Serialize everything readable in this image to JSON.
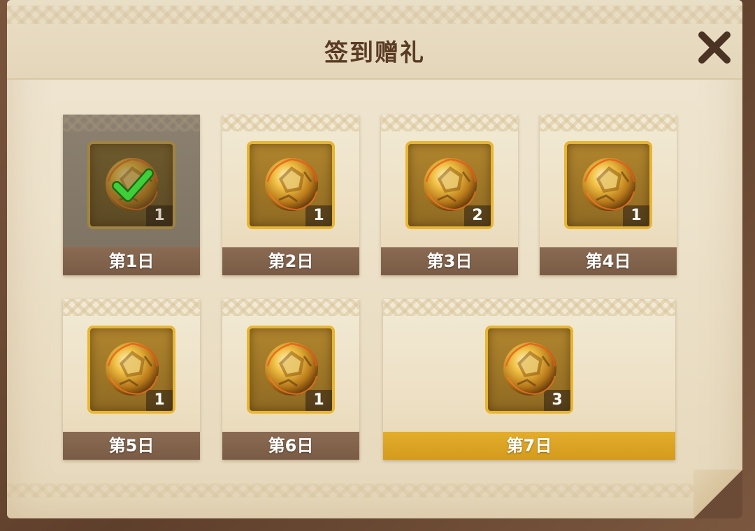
{
  "dialog": {
    "title": "签到赠礼",
    "close_icon": "close-icon"
  },
  "days": [
    {
      "label": "第1日",
      "count": "1",
      "claimed": true
    },
    {
      "label": "第2日",
      "count": "1",
      "claimed": false
    },
    {
      "label": "第3日",
      "count": "2",
      "claimed": false
    },
    {
      "label": "第4日",
      "count": "1",
      "claimed": false
    },
    {
      "label": "第5日",
      "count": "1",
      "claimed": false
    },
    {
      "label": "第6日",
      "count": "1",
      "claimed": false
    },
    {
      "label": "第7日",
      "count": "3",
      "claimed": false
    }
  ],
  "colors": {
    "title_text": "#5a3b24",
    "day_bar": "#7a5c46",
    "day_bar_highlight": "#d49a1c",
    "item_border": "#e8b632",
    "check_green": "#3fcf3a"
  },
  "icons": {
    "reward_item": "gold-ball-icon",
    "claimed_mark": "checkmark-icon"
  }
}
